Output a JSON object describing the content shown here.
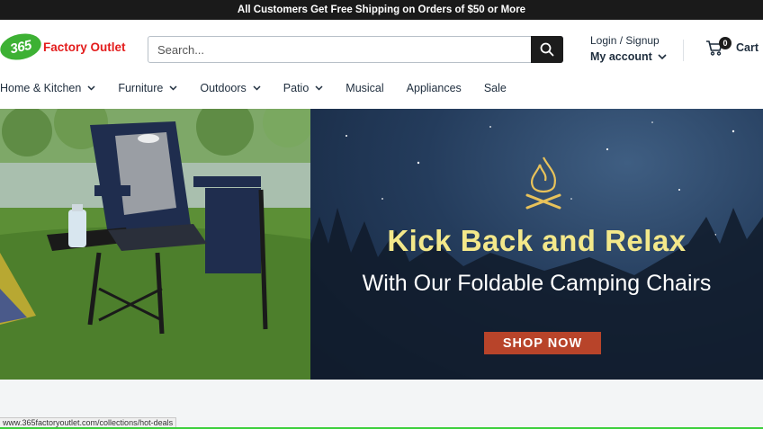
{
  "announcement": "All Customers Get Free Shipping on Orders of $50 or More",
  "logo": {
    "badge": "365",
    "text": "Factory Outlet"
  },
  "search": {
    "placeholder": "Search..."
  },
  "account": {
    "login": "Login / Signup",
    "my_account": "My account"
  },
  "cart": {
    "count": "0",
    "label": "Cart"
  },
  "nav": [
    {
      "label": "Home & Kitchen",
      "dropdown": true
    },
    {
      "label": "Furniture",
      "dropdown": true
    },
    {
      "label": "Outdoors",
      "dropdown": true
    },
    {
      "label": "Patio",
      "dropdown": true
    },
    {
      "label": "Musical",
      "dropdown": false
    },
    {
      "label": "Appliances",
      "dropdown": false
    },
    {
      "label": "Sale",
      "dropdown": false
    }
  ],
  "hero": {
    "headline": "Kick Back and Relax",
    "subline": "With Our Foldable Camping Chairs",
    "cta": "SHOP NOW",
    "colors": {
      "headline": "#f3e88a",
      "cta_bg": "#b8442a"
    }
  },
  "status_bar": {
    "url": "www.365factoryoutlet.com/collections/hot-deals"
  },
  "colors": {
    "brand_green": "#3db134",
    "brand_red": "#e31c1c",
    "dark": "#1c1c1c"
  }
}
